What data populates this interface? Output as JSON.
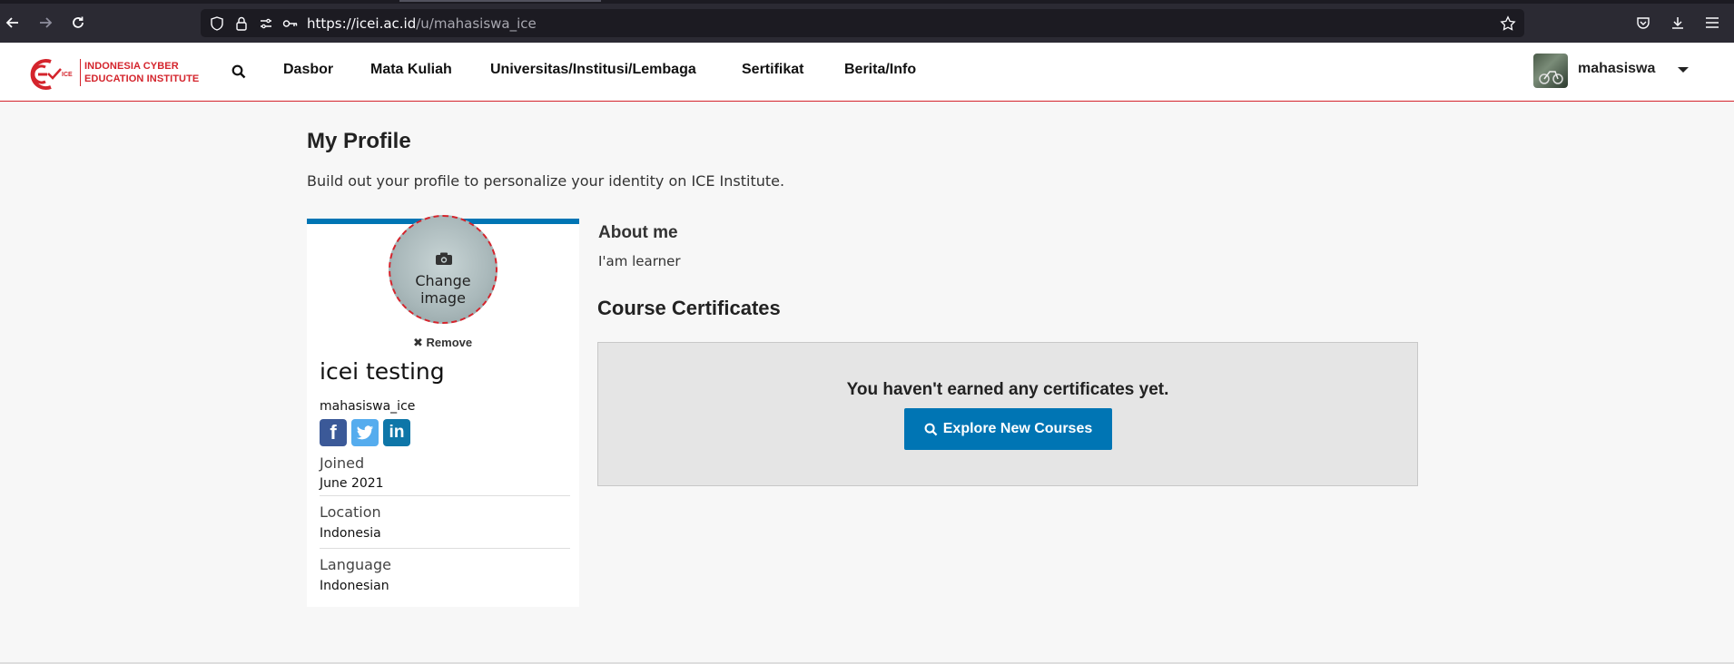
{
  "browser": {
    "url_host": "https://icei.ac.id",
    "url_path": "/u/mahasiswa_ice"
  },
  "site": {
    "logo_line1": "INDONESIA CYBER",
    "logo_line2": "EDUCATION INSTITUTE",
    "logo_mark": "ICE",
    "nav": [
      "Dasbor",
      "Mata Kuliah",
      "Universitas/Institusi/Lembaga",
      "Sertifikat",
      "Berita/Info"
    ],
    "username": "mahasiswa"
  },
  "main": {
    "title": "My Profile",
    "subtitle": "Build out your profile to personalize your identity on ICE Institute."
  },
  "profile": {
    "change_image": "Change image",
    "remove": "Remove",
    "full_name": "icei testing",
    "handle": "mahasiswa_ice",
    "joined_label": "Joined",
    "joined_value": "June 2021",
    "location_label": "Location",
    "location_value": "Indonesia",
    "language_label": "Language",
    "language_value": "Indonesian"
  },
  "about": {
    "title": "About me",
    "text": "I'am learner"
  },
  "certificates": {
    "title": "Course Certificates",
    "empty": "You haven't earned any certificates yet.",
    "explore": "Explore New Courses"
  },
  "colors": {
    "brand_red": "#d4242c",
    "primary_blue": "#0075b4",
    "facebook": "#3b5998",
    "twitter": "#55acee",
    "linkedin": "#0e76a8"
  }
}
